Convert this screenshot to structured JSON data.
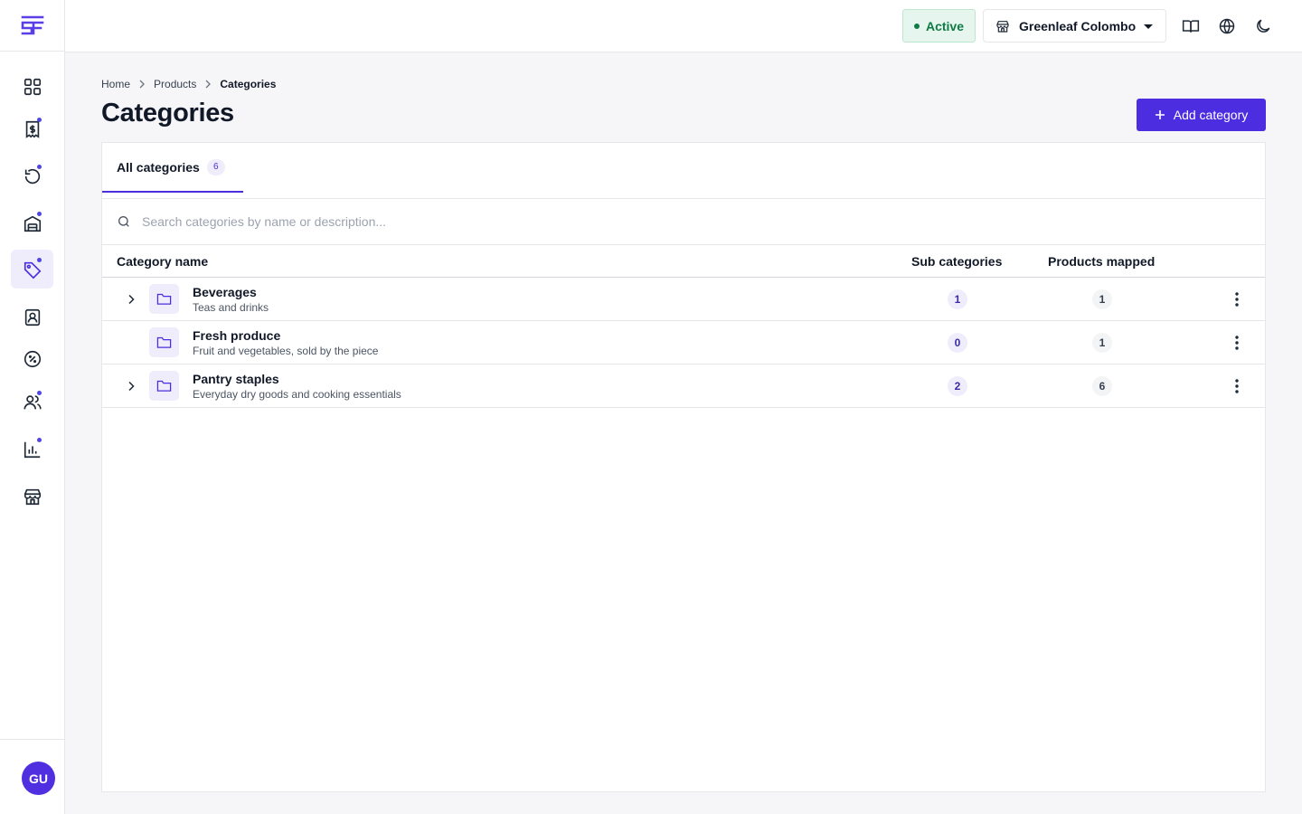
{
  "header": {
    "status": "Active",
    "store_name": "Greenleaf Colombo",
    "colors": {
      "accent": "#4c2ee0",
      "status_green": "#0f7a45"
    }
  },
  "sidebar": {
    "items": [
      {
        "icon": "dashboard-icon"
      },
      {
        "icon": "invoice-icon",
        "badge": true
      },
      {
        "icon": "returns-icon",
        "badge": true
      },
      {
        "icon": "warehouse-icon",
        "badge": true
      },
      {
        "icon": "tag-icon",
        "badge": true,
        "active": true
      },
      {
        "icon": "contacts-icon"
      },
      {
        "icon": "discount-icon"
      },
      {
        "icon": "users-icon",
        "badge": true
      },
      {
        "icon": "reports-icon",
        "badge": true
      },
      {
        "icon": "store-icon"
      }
    ],
    "user_initials": "GU"
  },
  "breadcrumb": {
    "home": "Home",
    "products": "Products",
    "current": "Categories"
  },
  "page": {
    "title": "Categories",
    "add_label": "Add category"
  },
  "tabs": [
    {
      "label": "All categories",
      "count": "6"
    }
  ],
  "search": {
    "placeholder": "Search categories by name or description..."
  },
  "table": {
    "columns": {
      "name": "Category name",
      "sub": "Sub categories",
      "products": "Products mapped"
    },
    "rows": [
      {
        "name": "Beverages",
        "description": "Teas and drinks",
        "sub": "1",
        "products": "1",
        "expandable": true
      },
      {
        "name": "Fresh produce",
        "description": "Fruit and vegetables, sold by the piece",
        "sub": "0",
        "products": "1",
        "expandable": false
      },
      {
        "name": "Pantry staples",
        "description": "Everyday dry goods and cooking essentials",
        "sub": "2",
        "products": "6",
        "expandable": true
      }
    ]
  }
}
